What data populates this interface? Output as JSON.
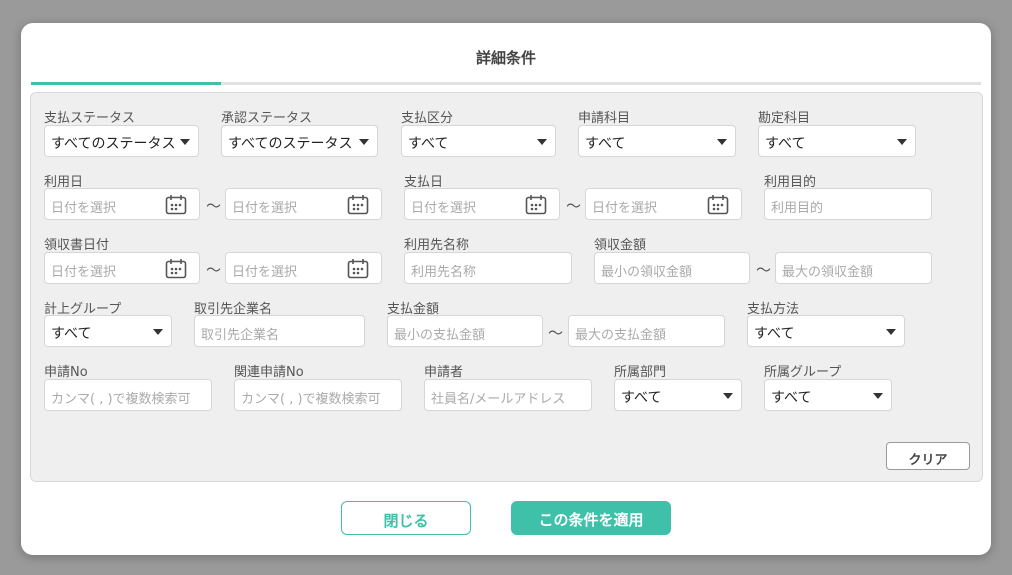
{
  "modal": {
    "title": "詳細条件"
  },
  "colors": {
    "accent": "#3ec0a9",
    "panel": "#efefef",
    "overlay": "#9a9a9a"
  },
  "row1": {
    "payment_status": {
      "label": "支払ステータス",
      "value": "すべてのステータス"
    },
    "approval_status": {
      "label": "承認ステータス",
      "value": "すべてのステータス"
    },
    "payment_type": {
      "label": "支払区分",
      "value": "すべて"
    },
    "application_item": {
      "label": "申請科目",
      "value": "すべて"
    },
    "account_item": {
      "label": "勘定科目",
      "value": "すべて"
    }
  },
  "row2": {
    "usage_date": {
      "label": "利用日",
      "from_placeholder": "日付を選択",
      "to_placeholder": "日付を選択"
    },
    "payment_date": {
      "label": "支払日",
      "from_placeholder": "日付を選択",
      "to_placeholder": "日付を選択"
    },
    "usage_purpose": {
      "label": "利用目的",
      "placeholder": "利用目的"
    }
  },
  "row3": {
    "receipt_date": {
      "label": "領収書日付",
      "from_placeholder": "日付を選択",
      "to_placeholder": "日付を選択"
    },
    "vendor_name": {
      "label": "利用先名称",
      "placeholder": "利用先名称"
    },
    "receipt_amount": {
      "label": "領収金額",
      "min_placeholder": "最小の領収金額",
      "max_placeholder": "最大の領収金額"
    }
  },
  "row4": {
    "booking_group": {
      "label": "計上グループ",
      "value": "すべて"
    },
    "partner_company": {
      "label": "取引先企業名",
      "placeholder": "取引先企業名"
    },
    "payment_amount": {
      "label": "支払金額",
      "min_placeholder": "最小の支払金額",
      "max_placeholder": "最大の支払金額"
    },
    "payment_method": {
      "label": "支払方法",
      "value": "すべて"
    }
  },
  "row5": {
    "application_no": {
      "label": "申請No",
      "placeholder": "カンマ( , )で複数検索可"
    },
    "related_application_no": {
      "label": "関連申請No",
      "placeholder": "カンマ( , )で複数検索可"
    },
    "applicant": {
      "label": "申請者",
      "placeholder": "社員名/メールアドレス"
    },
    "department": {
      "label": "所属部門",
      "value": "すべて"
    },
    "group": {
      "label": "所属グループ",
      "value": "すべて"
    }
  },
  "tilde": "〜",
  "buttons": {
    "clear": "クリア",
    "close": "閉じる",
    "apply": "この条件を適用"
  },
  "icons": {
    "calendar": "calendar-icon",
    "dropdown": "chevron-down-icon"
  }
}
